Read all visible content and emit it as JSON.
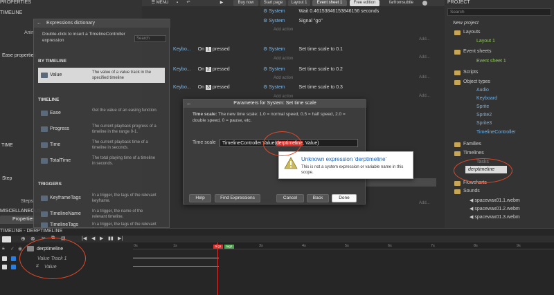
{
  "left_panel": {
    "title": "PROPERTIES",
    "timeline_header": "TIMELINE",
    "animation_label": "Anim",
    "ease_props": "Ease properties",
    "time_header": "TIME",
    "step_header": "Step",
    "steps_label": "Steps",
    "misc_header": "MISCELLANEOUS",
    "properties_tab": "Properties"
  },
  "toolbar": {
    "menu": "MENU",
    "buy_now": "Buy now",
    "start_page": "Start page",
    "layout_tab": "Layout 1",
    "event_sheet_tab": "Event sheet 1",
    "edition": "Free edition",
    "username": "farfromsubtle"
  },
  "event_sheet": {
    "rows": [
      {
        "object": "System",
        "action": "Wait 0.46153846153846156 seconds"
      },
      {
        "object": "System",
        "action": "Signal \"go\""
      }
    ],
    "events": [
      {
        "condition_obj": "Keybo...",
        "condition": "On",
        "key": "1",
        "key_suffix": "pressed",
        "object": "System",
        "action": "Set time scale to 0.1"
      },
      {
        "condition_obj": "Keybo...",
        "condition": "On",
        "key": "2",
        "key_suffix": "pressed",
        "object": "System",
        "action": "Set time scale to 0.2"
      },
      {
        "condition_obj": "Keybo...",
        "condition": "On",
        "key": "3",
        "key_suffix": "pressed",
        "object": "System",
        "action": "Set time scale to 0.3"
      }
    ],
    "add_action": "Add action",
    "add_action_short": "Add..."
  },
  "dictionary": {
    "title": "Expressions dictionary",
    "instruction": "Double-click to insert a TimelineController expression",
    "search_placeholder": "Search",
    "section_by_timeline": "BY TIMELINE",
    "selected_item": {
      "name": "Value",
      "desc": "The value of a value track in the specified timeline"
    },
    "section_timeline": "TIMELINE",
    "timeline_items": [
      {
        "name": "Ease",
        "desc": "Get the value of an easing function."
      },
      {
        "name": "Progress",
        "desc": "The current playback progress of a timeline in the range 0-1."
      },
      {
        "name": "Time",
        "desc": "The current playback time of a timeline in seconds."
      },
      {
        "name": "TotalTime",
        "desc": "The total playing time of a timeline in seconds."
      }
    ],
    "section_triggers": "TRIGGERS",
    "trigger_items": [
      {
        "name": "KeyframeTags",
        "desc": "In a trigger, the tags of the relevant keyframe."
      },
      {
        "name": "TimelineName",
        "desc": "In a trigger, the name of the relevant timeline."
      },
      {
        "name": "TimelineTags",
        "desc": "In a trigger, the tags of the relevant timeline."
      }
    ]
  },
  "param_dialog": {
    "title": "Parameters for System: Set time scale",
    "desc_bold": "Time scale:",
    "desc": "The new time scale: 1.0 = normal speed, 0.5 = half speed, 2.0 = double speed, 0 = pause, etc.",
    "field_label": "Time scale",
    "value_prefix": "TimelineController.Value(",
    "value_error": "derptimeline",
    "value_suffix": ", Value)",
    "buttons": {
      "help": "Help",
      "find": "Find Expressions",
      "cancel": "Cancel",
      "back": "Back",
      "done": "Done"
    }
  },
  "error_tooltip": {
    "title": "Unknown expression 'derptimeline'",
    "message": "This is not a system expression or variable name in this scope."
  },
  "project": {
    "title": "PROJECT",
    "search_placeholder": "Search",
    "root": "New project",
    "layouts": "Layouts",
    "layout_item": "Layout 1",
    "event_sheets": "Event sheets",
    "event_sheet_item": "Event sheet 1",
    "scripts": "Scripts",
    "object_types": "Object types",
    "objects": [
      "Audio",
      "Keyboard",
      "Sprite",
      "Sprite2",
      "Sprite3",
      "TimelineController"
    ],
    "families": "Families",
    "timelines": "Timelines",
    "timeline_items": [
      "Tasks",
      "derptimeline"
    ],
    "flowcharts": "Flowcharts",
    "sounds": "Sounds",
    "sound_items": [
      "spacewax01.1.webm",
      "spacewax01.2.webm",
      "spacewax01.3.webm"
    ]
  },
  "timeline_panel": {
    "title": "TIMELINE - DERPTIMELINE",
    "timeline_name": "derptimeline",
    "track": "Value Track 1",
    "property": "Value",
    "ticks": [
      "0s",
      "1s",
      "2s",
      "3s",
      "4s",
      "5s",
      "6s",
      "7s",
      "8s",
      "9s"
    ],
    "marker_tags": [
      "tag1",
      "tag2"
    ]
  },
  "colors": {
    "accent_blue": "#2a7de1",
    "error_red": "#d4322e",
    "annotation": "#e04a2a",
    "object_blue": "#6fb3e8",
    "layout_green": "#8fc85a"
  }
}
